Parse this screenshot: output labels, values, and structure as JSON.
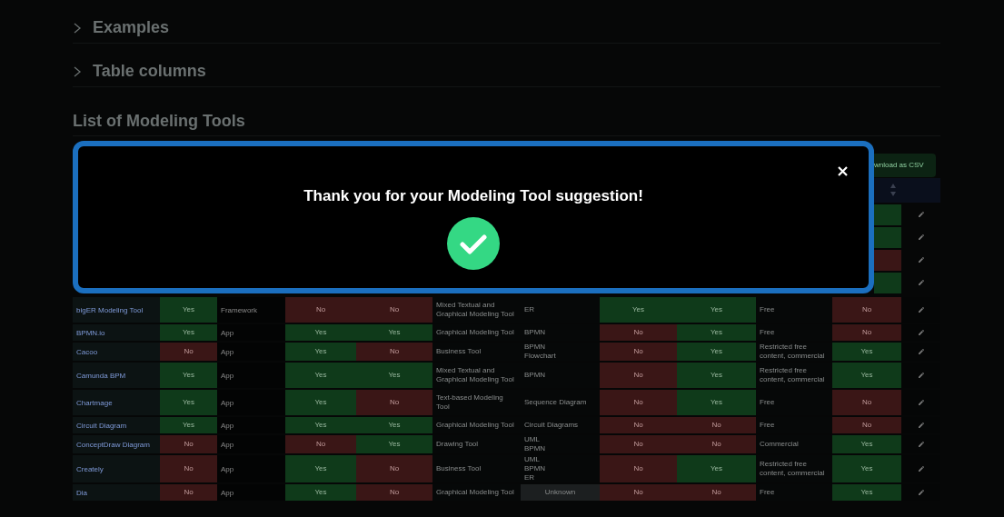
{
  "sections": [
    {
      "label": "Examples",
      "expanded": false
    },
    {
      "label": "Table columns",
      "expanded": false
    }
  ],
  "list_title": "List of Modeling Tools",
  "download_button": "wnload as CSV",
  "partial_rows": [
    {
      "positive": true
    },
    {
      "positive": true
    },
    {
      "positive": false
    },
    {
      "positive": true
    }
  ],
  "rows": [
    {
      "name": "bigER Modeling Tool",
      "col2": {
        "text": "Yes",
        "positive": true
      },
      "type": "Framework",
      "col4": {
        "text": "No",
        "positive": false
      },
      "col5": {
        "text": "No",
        "positive": false
      },
      "category": "Mixed Textual and Graphical Modeling Tool",
      "languages": [
        "ER"
      ],
      "col8": {
        "text": "Yes",
        "positive": true
      },
      "col9": {
        "text": "Yes",
        "positive": true
      },
      "license": "Free",
      "col11": {
        "text": "No",
        "positive": false
      }
    },
    {
      "name": "BPMN.io",
      "col2": {
        "text": "Yes",
        "positive": true
      },
      "type": "App",
      "col4": {
        "text": "Yes",
        "positive": true
      },
      "col5": {
        "text": "Yes",
        "positive": true
      },
      "category": "Graphical Modeling Tool",
      "languages": [
        "BPMN"
      ],
      "col8": {
        "text": "No",
        "positive": false
      },
      "col9": {
        "text": "Yes",
        "positive": true
      },
      "license": "Free",
      "col11": {
        "text": "No",
        "positive": false
      }
    },
    {
      "name": "Cacoo",
      "col2": {
        "text": "No",
        "positive": false
      },
      "type": "App",
      "col4": {
        "text": "Yes",
        "positive": true
      },
      "col5": {
        "text": "No",
        "positive": false
      },
      "category": "Business Tool",
      "languages": [
        "BPMN",
        "Flowchart"
      ],
      "col8": {
        "text": "No",
        "positive": false
      },
      "col9": {
        "text": "Yes",
        "positive": true
      },
      "license": "Restricted free content, commercial",
      "col11": {
        "text": "Yes",
        "positive": true
      }
    },
    {
      "name": "Camunda BPM",
      "col2": {
        "text": "Yes",
        "positive": true
      },
      "type": "App",
      "col4": {
        "text": "Yes",
        "positive": true
      },
      "col5": {
        "text": "Yes",
        "positive": true
      },
      "category": "Mixed Textual and Graphical Modeling Tool",
      "languages": [
        "BPMN"
      ],
      "col8": {
        "text": "No",
        "positive": false
      },
      "col9": {
        "text": "Yes",
        "positive": true
      },
      "license": "Restricted free content, commercial",
      "col11": {
        "text": "Yes",
        "positive": true
      }
    },
    {
      "name": "Chartmage",
      "col2": {
        "text": "Yes",
        "positive": true
      },
      "type": "App",
      "col4": {
        "text": "Yes",
        "positive": true
      },
      "col5": {
        "text": "No",
        "positive": false
      },
      "category": "Text-based Modeling Tool",
      "languages": [
        "Sequence Diagram"
      ],
      "col8": {
        "text": "No",
        "positive": false
      },
      "col9": {
        "text": "Yes",
        "positive": true
      },
      "license": "Free",
      "col11": {
        "text": "No",
        "positive": false
      }
    },
    {
      "name": "Circuit Diagram",
      "col2": {
        "text": "Yes",
        "positive": true
      },
      "type": "App",
      "col4": {
        "text": "Yes",
        "positive": true
      },
      "col5": {
        "text": "Yes",
        "positive": true
      },
      "category": "Graphical Modeling Tool",
      "languages": [
        "Circuit Diagrams"
      ],
      "col8": {
        "text": "No",
        "positive": false
      },
      "col9": {
        "text": "No",
        "positive": false
      },
      "license": "Free",
      "col11": {
        "text": "No",
        "positive": false
      }
    },
    {
      "name": "ConceptDraw Diagram",
      "col2": {
        "text": "No",
        "positive": false
      },
      "type": "App",
      "col4": {
        "text": "No",
        "positive": false
      },
      "col5": {
        "text": "Yes",
        "positive": true
      },
      "category": "Drawing Tool",
      "languages": [
        "UML",
        "BPMN"
      ],
      "col8": {
        "text": "No",
        "positive": false
      },
      "col9": {
        "text": "No",
        "positive": false
      },
      "license": "Commercial",
      "col11": {
        "text": "Yes",
        "positive": true
      }
    },
    {
      "name": "Creately",
      "col2": {
        "text": "No",
        "positive": false
      },
      "type": "App",
      "col4": {
        "text": "Yes",
        "positive": true
      },
      "col5": {
        "text": "No",
        "positive": false
      },
      "category": "Business Tool",
      "languages": [
        "UML",
        "BPMN",
        "ER"
      ],
      "col8": {
        "text": "No",
        "positive": false
      },
      "col9": {
        "text": "Yes",
        "positive": true
      },
      "license": "Restricted free content, commercial",
      "col11": {
        "text": "Yes",
        "positive": true
      }
    },
    {
      "name": "Dia",
      "col2": {
        "text": "No",
        "positive": false
      },
      "type": "App",
      "col4": {
        "text": "Yes",
        "positive": true
      },
      "col5": {
        "text": "No",
        "positive": false
      },
      "category": "Graphical Modeling Tool",
      "languages_badge": "Unknown",
      "col8": {
        "text": "No",
        "positive": false
      },
      "col9": {
        "text": "No",
        "positive": false
      },
      "license": "Free",
      "col11": {
        "text": "Yes",
        "positive": true
      }
    }
  ],
  "modal": {
    "message": "Thank you for your Modeling Tool suggestion!"
  }
}
